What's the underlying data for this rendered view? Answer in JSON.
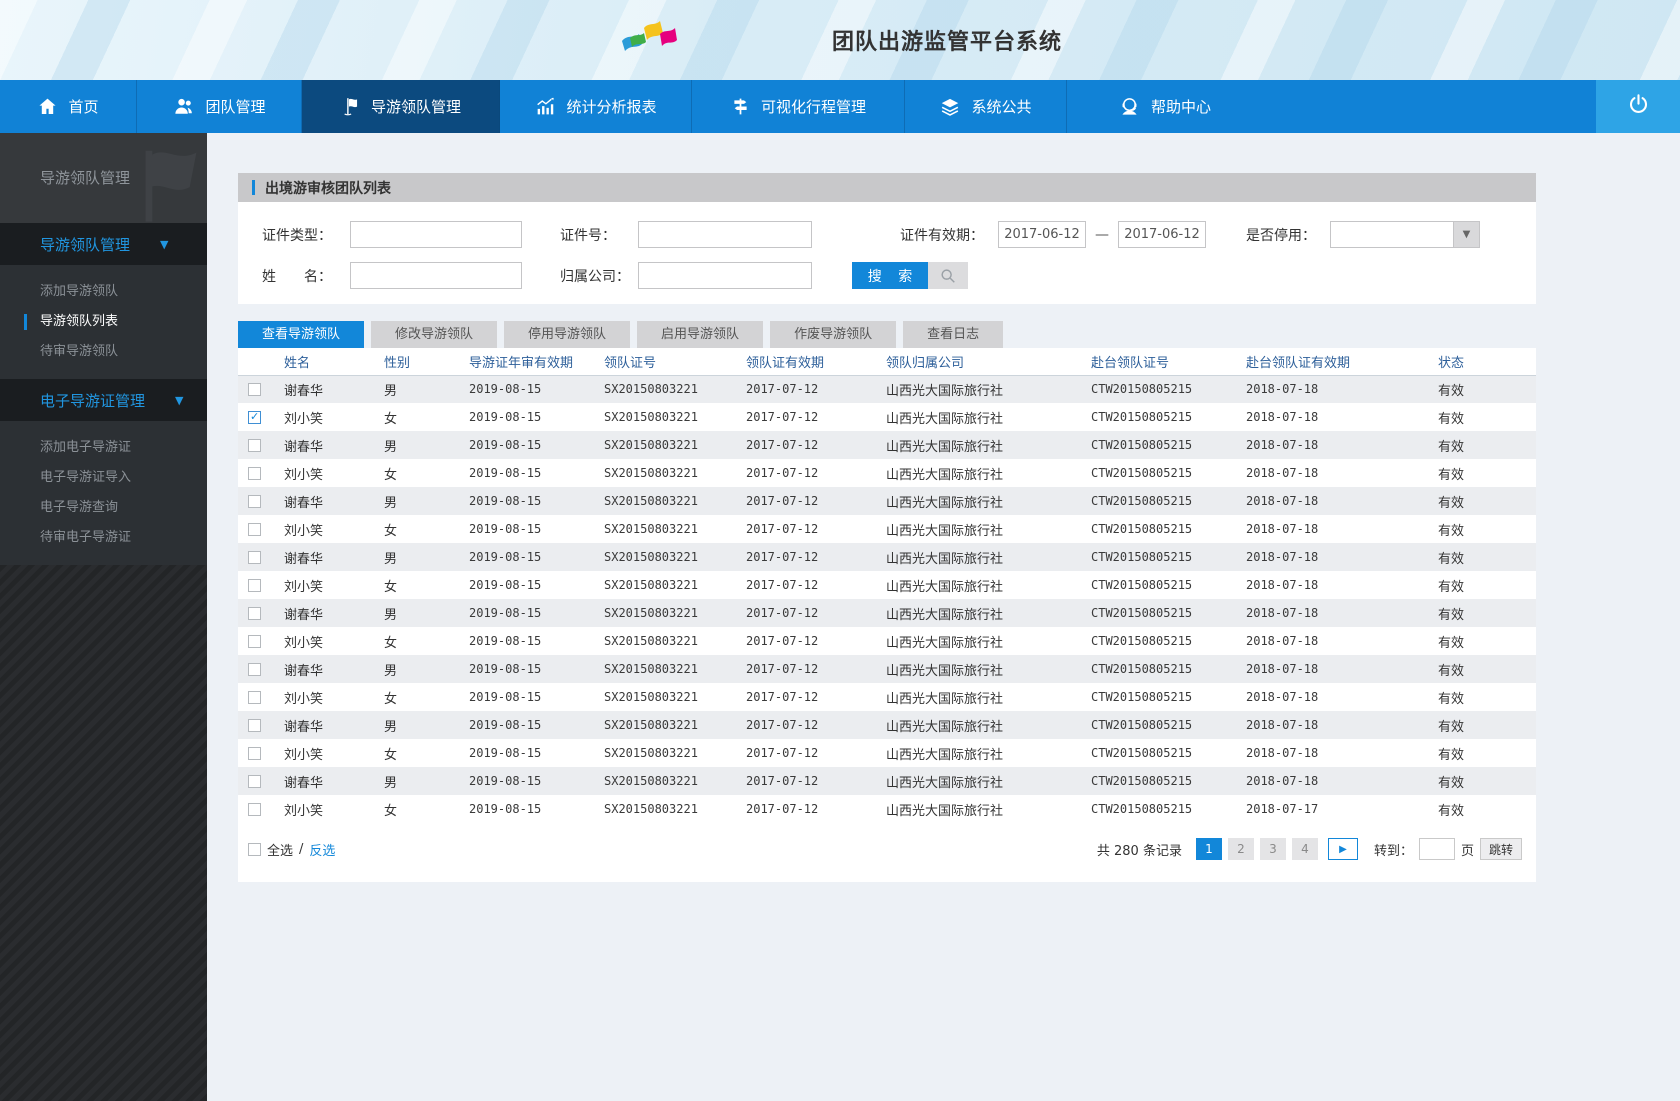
{
  "colors": {
    "accent": "#1287d9",
    "nav": "#1182d6",
    "nav_active": "#0c4a7f",
    "sidebar_link": "#2196e0"
  },
  "header": {
    "title": "团队出游监管平台系统",
    "logo_icon": "flags-logo-icon"
  },
  "nav": {
    "items": [
      {
        "label": "首页",
        "icon": "home-icon",
        "active": false
      },
      {
        "label": "团队管理",
        "icon": "team-icon",
        "active": false
      },
      {
        "label": "导游领队管理",
        "icon": "flag-icon",
        "active": true
      },
      {
        "label": "统计分析报表",
        "icon": "chart-icon",
        "active": false
      },
      {
        "label": "可视化行程管理",
        "icon": "signpost-icon",
        "active": false
      },
      {
        "label": "系统公共",
        "icon": "layers-icon",
        "active": false
      },
      {
        "label": "帮助中心",
        "icon": "headset-icon",
        "active": false
      }
    ],
    "power_icon": "power-icon"
  },
  "sidebar": {
    "title": "导游领队管理",
    "watermark_icon": "flag-watermark-icon",
    "groups": [
      {
        "label": "导游领队管理",
        "arrow": "▼",
        "items": [
          {
            "label": "添加导游领队",
            "active": false
          },
          {
            "label": "导游领队列表",
            "active": true
          },
          {
            "label": "待审导游领队",
            "active": false
          }
        ]
      },
      {
        "label": "电子导游证管理",
        "arrow": "▼",
        "items": [
          {
            "label": "添加电子导游证",
            "active": false
          },
          {
            "label": "电子导游证导入",
            "active": false
          },
          {
            "label": "电子导游查询",
            "active": false
          },
          {
            "label": "待审电子导游证",
            "active": false
          }
        ]
      }
    ]
  },
  "panel": {
    "title": "出境游审核团队列表",
    "search": {
      "cert_type_label": "证件类型：",
      "cert_no_label": "证件号：",
      "cert_valid_label": "证件有效期：",
      "date_from": "2017-06-12",
      "date_separator": "—",
      "date_to": "2017-06-12",
      "disabled_label": "是否停用：",
      "disabled_value": "",
      "dropdown_icon": "▼",
      "name_label": "姓　　名：",
      "company_label": "归属公司：",
      "search_button": "搜 索",
      "search_icon": "magnifier-icon"
    },
    "tabs": [
      {
        "label": "查看导游领队",
        "active": true
      },
      {
        "label": "修改导游领队",
        "active": false
      },
      {
        "label": "停用导游领队",
        "active": false
      },
      {
        "label": "启用导游领队",
        "active": false
      },
      {
        "label": "作废导游领队",
        "active": false
      },
      {
        "label": "查看日志",
        "active": false
      }
    ],
    "table": {
      "columns": [
        "姓名",
        "性别",
        "导游证年审有效期",
        "领队证号",
        "领队证有效期",
        "领队归属公司",
        "赴台领队证号",
        "赴台领队证有效期",
        "状态"
      ],
      "rows": [
        {
          "checked": false,
          "name": "谢春华",
          "gender": "男",
          "annual": "2019-08-15",
          "cert_no": "SX20150803221",
          "cert_valid": "2017-07-12",
          "company": "山西光大国际旅行社",
          "tw_no": "CTW20150805215",
          "tw_valid": "2018-07-18",
          "status": "有效"
        },
        {
          "checked": true,
          "name": "刘小笑",
          "gender": "女",
          "annual": "2019-08-15",
          "cert_no": "SX20150803221",
          "cert_valid": "2017-07-12",
          "company": "山西光大国际旅行社",
          "tw_no": "CTW20150805215",
          "tw_valid": "2018-07-18",
          "status": "有效"
        },
        {
          "checked": false,
          "name": "谢春华",
          "gender": "男",
          "annual": "2019-08-15",
          "cert_no": "SX20150803221",
          "cert_valid": "2017-07-12",
          "company": "山西光大国际旅行社",
          "tw_no": "CTW20150805215",
          "tw_valid": "2018-07-18",
          "status": "有效"
        },
        {
          "checked": false,
          "name": "刘小笑",
          "gender": "女",
          "annual": "2019-08-15",
          "cert_no": "SX20150803221",
          "cert_valid": "2017-07-12",
          "company": "山西光大国际旅行社",
          "tw_no": "CTW20150805215",
          "tw_valid": "2018-07-18",
          "status": "有效"
        },
        {
          "checked": false,
          "name": "谢春华",
          "gender": "男",
          "annual": "2019-08-15",
          "cert_no": "SX20150803221",
          "cert_valid": "2017-07-12",
          "company": "山西光大国际旅行社",
          "tw_no": "CTW20150805215",
          "tw_valid": "2018-07-18",
          "status": "有效"
        },
        {
          "checked": false,
          "name": "刘小笑",
          "gender": "女",
          "annual": "2019-08-15",
          "cert_no": "SX20150803221",
          "cert_valid": "2017-07-12",
          "company": "山西光大国际旅行社",
          "tw_no": "CTW20150805215",
          "tw_valid": "2018-07-18",
          "status": "有效"
        },
        {
          "checked": false,
          "name": "谢春华",
          "gender": "男",
          "annual": "2019-08-15",
          "cert_no": "SX20150803221",
          "cert_valid": "2017-07-12",
          "company": "山西光大国际旅行社",
          "tw_no": "CTW20150805215",
          "tw_valid": "2018-07-18",
          "status": "有效"
        },
        {
          "checked": false,
          "name": "刘小笑",
          "gender": "女",
          "annual": "2019-08-15",
          "cert_no": "SX20150803221",
          "cert_valid": "2017-07-12",
          "company": "山西光大国际旅行社",
          "tw_no": "CTW20150805215",
          "tw_valid": "2018-07-18",
          "status": "有效"
        },
        {
          "checked": false,
          "name": "谢春华",
          "gender": "男",
          "annual": "2019-08-15",
          "cert_no": "SX20150803221",
          "cert_valid": "2017-07-12",
          "company": "山西光大国际旅行社",
          "tw_no": "CTW20150805215",
          "tw_valid": "2018-07-18",
          "status": "有效"
        },
        {
          "checked": false,
          "name": "刘小笑",
          "gender": "女",
          "annual": "2019-08-15",
          "cert_no": "SX20150803221",
          "cert_valid": "2017-07-12",
          "company": "山西光大国际旅行社",
          "tw_no": "CTW20150805215",
          "tw_valid": "2018-07-18",
          "status": "有效"
        },
        {
          "checked": false,
          "name": "谢春华",
          "gender": "男",
          "annual": "2019-08-15",
          "cert_no": "SX20150803221",
          "cert_valid": "2017-07-12",
          "company": "山西光大国际旅行社",
          "tw_no": "CTW20150805215",
          "tw_valid": "2018-07-18",
          "status": "有效"
        },
        {
          "checked": false,
          "name": "刘小笑",
          "gender": "女",
          "annual": "2019-08-15",
          "cert_no": "SX20150803221",
          "cert_valid": "2017-07-12",
          "company": "山西光大国际旅行社",
          "tw_no": "CTW20150805215",
          "tw_valid": "2018-07-18",
          "status": "有效"
        },
        {
          "checked": false,
          "name": "谢春华",
          "gender": "男",
          "annual": "2019-08-15",
          "cert_no": "SX20150803221",
          "cert_valid": "2017-07-12",
          "company": "山西光大国际旅行社",
          "tw_no": "CTW20150805215",
          "tw_valid": "2018-07-18",
          "status": "有效"
        },
        {
          "checked": false,
          "name": "刘小笑",
          "gender": "女",
          "annual": "2019-08-15",
          "cert_no": "SX20150803221",
          "cert_valid": "2017-07-12",
          "company": "山西光大国际旅行社",
          "tw_no": "CTW20150805215",
          "tw_valid": "2018-07-18",
          "status": "有效"
        },
        {
          "checked": false,
          "name": "谢春华",
          "gender": "男",
          "annual": "2019-08-15",
          "cert_no": "SX20150803221",
          "cert_valid": "2017-07-12",
          "company": "山西光大国际旅行社",
          "tw_no": "CTW20150805215",
          "tw_valid": "2018-07-18",
          "status": "有效"
        },
        {
          "checked": false,
          "name": "刘小笑",
          "gender": "女",
          "annual": "2019-08-15",
          "cert_no": "SX20150803221",
          "cert_valid": "2017-07-12",
          "company": "山西光大国际旅行社",
          "tw_no": "CTW20150805215",
          "tw_valid": "2018-07-17",
          "status": "有效"
        }
      ]
    },
    "footer": {
      "select_all": "全选",
      "separator": "/",
      "invert": "反选",
      "total_text": "共 280 条记录",
      "pages": [
        {
          "label": "1",
          "active": true
        },
        {
          "label": "2",
          "active": false
        },
        {
          "label": "3",
          "active": false
        },
        {
          "label": "4",
          "active": false
        }
      ],
      "next_icon": "▶",
      "goto_label": "转到：",
      "goto_value": "",
      "page_word": "页",
      "jump_button": "跳转"
    }
  }
}
